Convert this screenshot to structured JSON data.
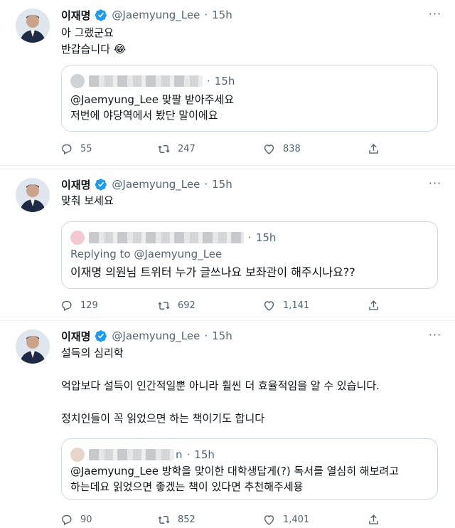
{
  "tweets": [
    {
      "name": "이재명",
      "handle": "@Jaemyung_Lee",
      "dot": "·",
      "time": "15h",
      "more": "···",
      "text": "아 그랬군요\n반갑습니다 😂",
      "quote": {
        "time": "15h",
        "reply_label": "",
        "text": "@Jaemyung_Lee 맞팔 받아주세요\n저번에 야당역에서 봤단 말이에요"
      },
      "replies": "55",
      "retweets": "247",
      "likes": "838"
    },
    {
      "name": "이재명",
      "handle": "@Jaemyung_Lee",
      "dot": "·",
      "time": "15h",
      "more": "···",
      "text": "맞춰 보세요",
      "quote": {
        "time": "15h",
        "reply_label": "Replying to @Jaemyung_Lee",
        "text": "이재명 의원님 트위터 누가 글쓰나요 보좌관이 해주시나요??"
      },
      "replies": "129",
      "retweets": "692",
      "likes": "1,141"
    },
    {
      "name": "이재명",
      "handle": "@Jaemyung_Lee",
      "dot": "·",
      "time": "15h",
      "more": "···",
      "text": "설득의 심리학\n\n억압보다 설득이 인간적일뿐 아니라 훨씬 더 효율적임을 알 수 있습니다.\n\n정치인들이 꼭 읽었으면 하는 책이기도 합니다",
      "quote": {
        "time": "15h",
        "name_suffix": "n",
        "reply_label": "",
        "text": "@Jaemyung_Lee 방학을 맞이한 대학생답게(?) 독서를 열심히 해보려고\n하는데요 읽었으면 좋겠는 책이 있다면 추천해주세용"
      },
      "replies": "90",
      "retweets": "852",
      "likes": "1,401"
    }
  ],
  "colors": {
    "verified": "#1d9bf0",
    "muted": "#536471",
    "border": "#cfd9de",
    "divider": "#eff3f4"
  },
  "icons": [
    "verified-badge-icon",
    "more-icon",
    "reply-icon",
    "retweet-icon",
    "like-icon",
    "share-icon"
  ]
}
